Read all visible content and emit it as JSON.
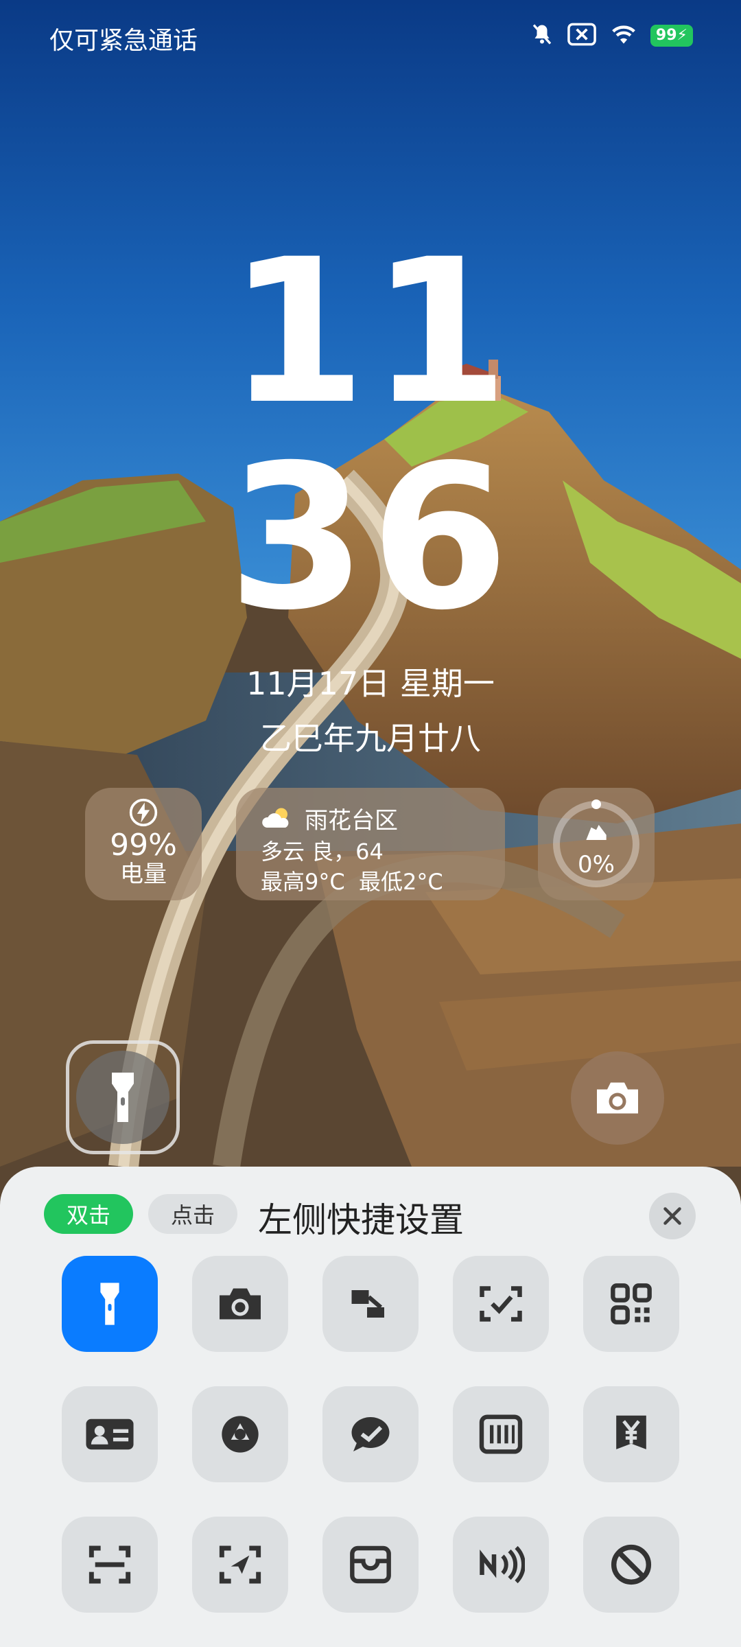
{
  "status_bar": {
    "carrier_text": "仅可紧急通话",
    "battery_text": "99"
  },
  "clock": {
    "hour": "11",
    "minute": "36"
  },
  "date": {
    "solar": "11月17日 星期一",
    "lunar": "乙巳年九月廿八"
  },
  "widgets": {
    "battery": {
      "value": "99%",
      "label": "电量"
    },
    "weather": {
      "location": "雨花台区",
      "condition": "多云 良，64",
      "range": "最高9°C  最低2°C"
    },
    "steps": {
      "value": "0%"
    }
  },
  "sheet": {
    "title": "左侧快捷设置",
    "tabs": [
      {
        "label": "双击"
      },
      {
        "label": "点击"
      }
    ]
  },
  "tiles": [
    [
      "flashlight-icon",
      "camera-icon",
      "video-record-icon",
      "scan-check-icon",
      "qr-code-icon"
    ],
    [
      "id-card-icon",
      "shutter-icon",
      "wechat-chat-icon",
      "barcode-icon",
      "pay-yuan-icon"
    ],
    [
      "scan-frame-icon",
      "send-scan-icon",
      "wallet-card-icon",
      "nfc-icon",
      "disable-icon"
    ]
  ],
  "colors": {
    "accent_blue": "#0a7cff",
    "accent_green": "#22c55e",
    "sheet_bg": "#eef0f1"
  }
}
